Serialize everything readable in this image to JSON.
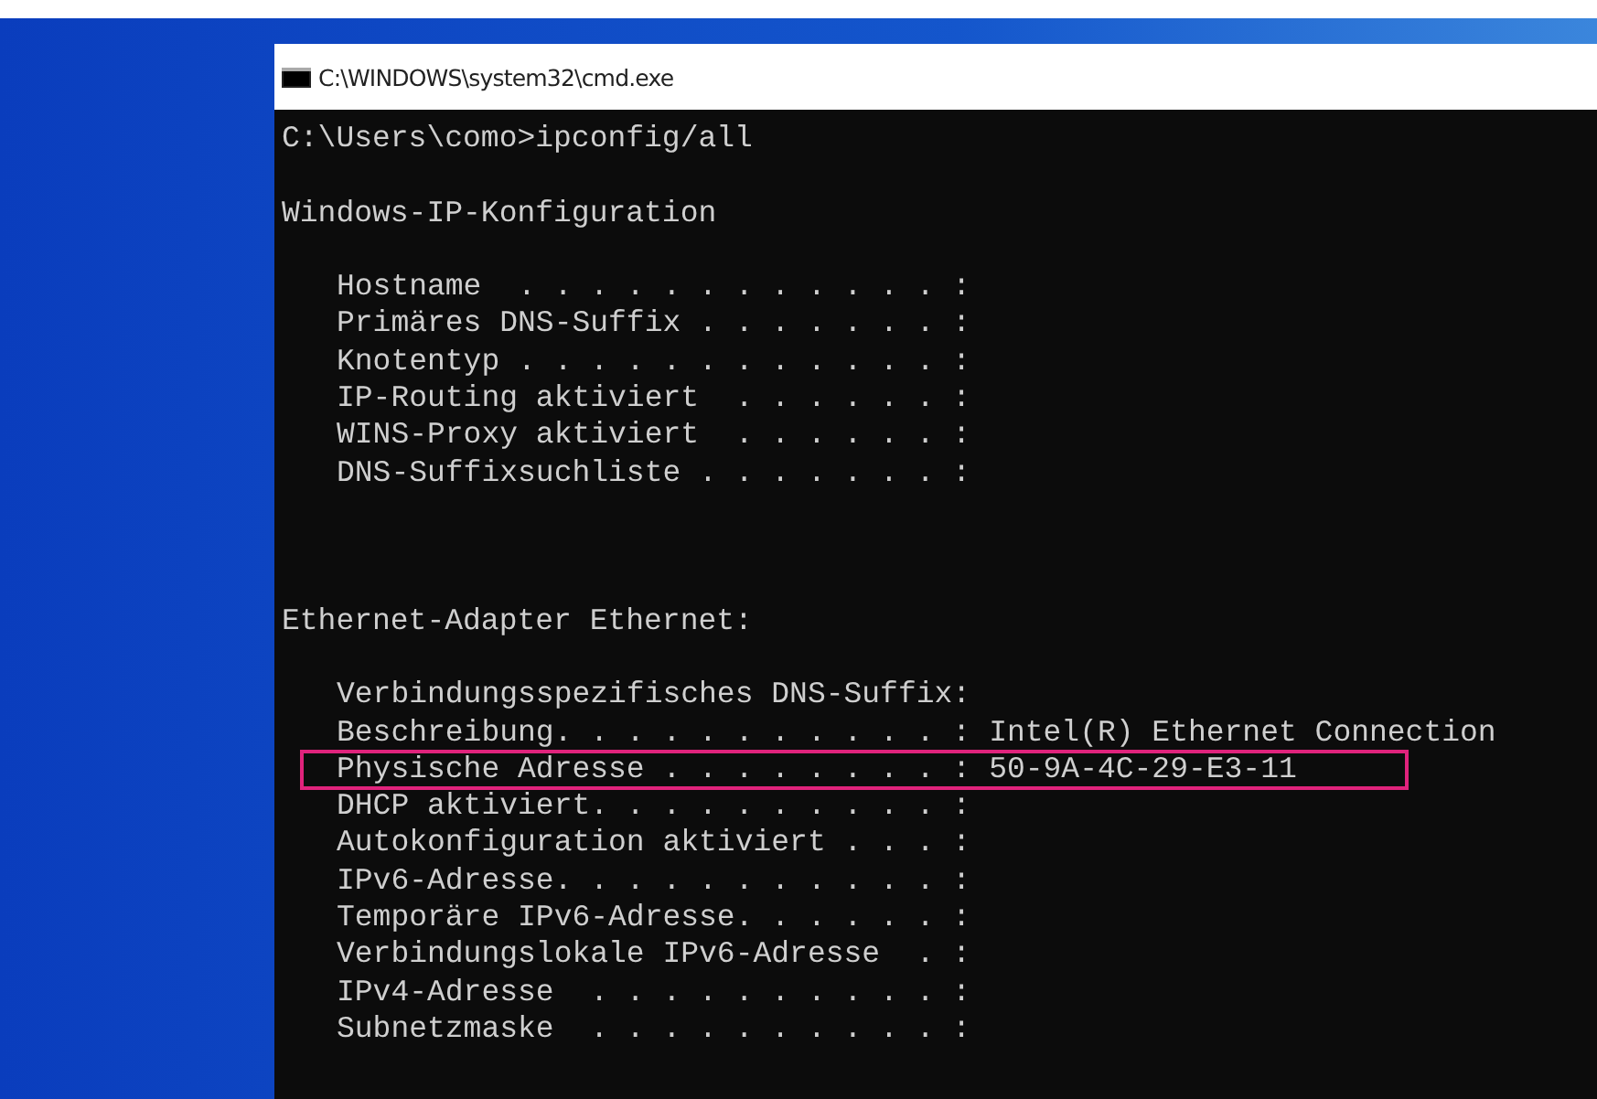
{
  "window": {
    "title": "C:\\WINDOWS\\system32\\cmd.exe"
  },
  "console": {
    "prompt": "C:\\Users\\como>ipconfig/all",
    "sections": [
      {
        "heading": "Windows-IP-Konfiguration",
        "entries": [
          {
            "label": "Hostname  . . . . . . . . . . . . :",
            "highlighted": false
          },
          {
            "label": "Primäres DNS-Suffix . . . . . . . :",
            "highlighted": false
          },
          {
            "label": "Knotentyp . . . . . . . . . . . . :",
            "highlighted": false
          },
          {
            "label": "IP-Routing aktiviert  . . . . . . :",
            "highlighted": false
          },
          {
            "label": "WINS-Proxy aktiviert  . . . . . . :",
            "highlighted": false
          },
          {
            "label": "DNS-Suffixsuchliste . . . . . . . :",
            "highlighted": false
          }
        ]
      },
      {
        "heading": "Ethernet-Adapter Ethernet:",
        "entries": [
          {
            "label": "Verbindungsspezifisches DNS-Suffix:",
            "highlighted": false
          },
          {
            "label": "Beschreibung. . . . . . . . . . . :",
            "value": "Intel(R) Ethernet Connection",
            "highlighted": false
          },
          {
            "label": "Physische Adresse . . . . . . . . :",
            "value": "50-9A-4C-29-E3-11",
            "highlighted": true
          },
          {
            "label": "DHCP aktiviert. . . . . . . . . . :",
            "highlighted": false
          },
          {
            "label": "Autokonfiguration aktiviert . . . :",
            "highlighted": false
          },
          {
            "label": "IPv6-Adresse. . . . . . . . . . . :",
            "highlighted": false
          },
          {
            "label": "Temporäre IPv6-Adresse. . . . . . :",
            "highlighted": false
          },
          {
            "label": "Verbindungslokale IPv6-Adresse  . :",
            "highlighted": false
          },
          {
            "label": "IPv4-Adresse  . . . . . . . . . . :",
            "highlighted": false
          },
          {
            "label": "Subnetzmaske  . . . . . . . . . . :",
            "highlighted": false
          }
        ]
      }
    ]
  }
}
